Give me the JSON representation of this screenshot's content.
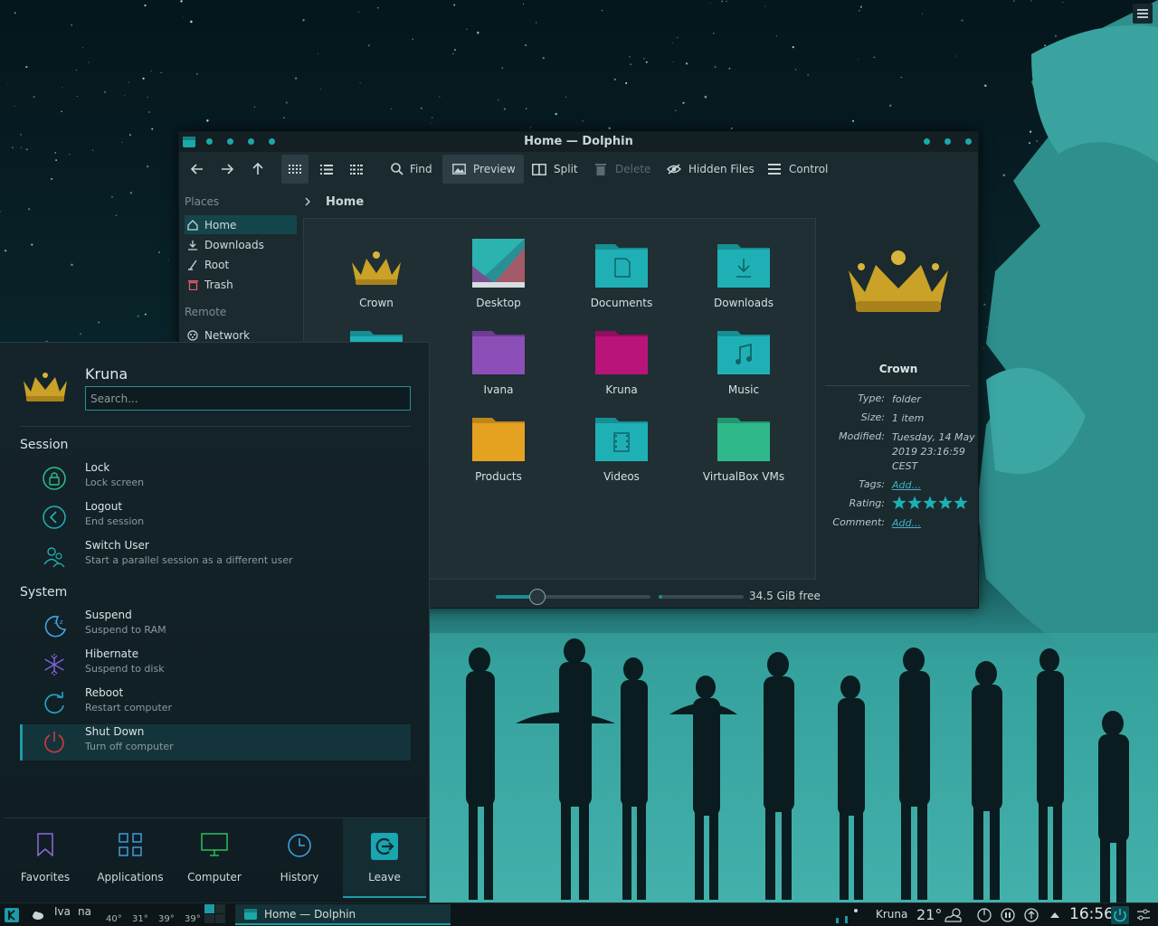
{
  "window": {
    "title": "Home — Dolphin"
  },
  "toolbar": {
    "find": "Find",
    "preview": "Preview",
    "split": "Split",
    "delete": "Delete",
    "hidden_files": "Hidden Files",
    "control": "Control"
  },
  "places": {
    "header": "Places",
    "items": [
      {
        "label": "Home",
        "icon": "home-icon"
      },
      {
        "label": "Downloads",
        "icon": "download-icon"
      },
      {
        "label": "Root",
        "icon": "root-icon"
      },
      {
        "label": "Trash",
        "icon": "trash-icon"
      }
    ],
    "remote_header": "Remote",
    "remote_items": [
      {
        "label": "Network",
        "icon": "network-icon"
      }
    ]
  },
  "breadcrumb": {
    "current": "Home"
  },
  "files": [
    {
      "name": "Crown",
      "color": "#c9a227",
      "icon": "crown-icon"
    },
    {
      "name": "Desktop",
      "color": "#2bb3b0",
      "icon": "desktop-folder-icon"
    },
    {
      "name": "Documents",
      "color": "#1fb0b5",
      "icon": "documents-folder-icon"
    },
    {
      "name": "Downloads",
      "color": "#1fb0b5",
      "icon": "downloads-folder-icon"
    },
    {
      "name": "Ivana",
      "color": "#8c4fb8",
      "icon": "folder-icon"
    },
    {
      "name": "Kruna",
      "color": "#b8147a",
      "icon": "folder-icon"
    },
    {
      "name": "Music",
      "color": "#1fb0b5",
      "icon": "music-folder-icon"
    },
    {
      "name": "Products",
      "color": "#e5a221",
      "icon": "folder-icon"
    },
    {
      "name": "Videos",
      "color": "#1fb0b5",
      "icon": "videos-folder-icon"
    },
    {
      "name": "VirtualBox VMs",
      "color": "#2fb88a",
      "icon": "folder-icon"
    }
  ],
  "info": {
    "name": "Crown",
    "type_label": "Type:",
    "type_value": "folder",
    "size_label": "Size:",
    "size_value": "1 item",
    "modified_label": "Modified:",
    "modified_value": "Tuesday, 14 May 2019 23:16:59 CEST",
    "tags_label": "Tags:",
    "tags_value": "Add...",
    "rating_label": "Rating:",
    "rating_value": 5,
    "comment_label": "Comment:",
    "comment_value": "Add..."
  },
  "status": {
    "free_space": "34.5 GiB free",
    "disk_used_fraction": 0.04,
    "zoom_fraction": 0.27
  },
  "launcher": {
    "user_name": "Kruna",
    "search_placeholder": "Search...",
    "session_title": "Session",
    "system_title": "System",
    "session": [
      {
        "title": "Lock",
        "subtitle": "Lock screen",
        "icon": "lock-icon"
      },
      {
        "title": "Logout",
        "subtitle": "End session",
        "icon": "logout-icon"
      },
      {
        "title": "Switch User",
        "subtitle": "Start a parallel session as a different user",
        "icon": "switch-user-icon"
      }
    ],
    "system": [
      {
        "title": "Suspend",
        "subtitle": "Suspend to RAM",
        "icon": "suspend-icon"
      },
      {
        "title": "Hibernate",
        "subtitle": "Suspend to disk",
        "icon": "hibernate-icon"
      },
      {
        "title": "Reboot",
        "subtitle": "Restart computer",
        "icon": "reboot-icon"
      },
      {
        "title": "Shut Down",
        "subtitle": "Turn off computer",
        "icon": "shutdown-icon"
      }
    ],
    "tabs": [
      {
        "label": "Favorites",
        "icon": "bookmark-icon"
      },
      {
        "label": "Applications",
        "icon": "grid-icon"
      },
      {
        "label": "Computer",
        "icon": "monitor-icon"
      },
      {
        "label": "History",
        "icon": "clock-icon"
      },
      {
        "label": "Leave",
        "icon": "leave-icon"
      }
    ]
  },
  "panel": {
    "weather_label_1": "Iva",
    "weather_label_2": "na",
    "temps": [
      "40°",
      "31°",
      "39°",
      "39°"
    ],
    "task_title": "Home — Dolphin",
    "user": "Kruna",
    "temperature": "21°",
    "clock": "16:56"
  },
  "colors": {
    "accent": "#1d9aa5",
    "folder_teal": "#1fb0b5",
    "star": "#1fb0b5",
    "crown_gold": "#c9a227"
  }
}
